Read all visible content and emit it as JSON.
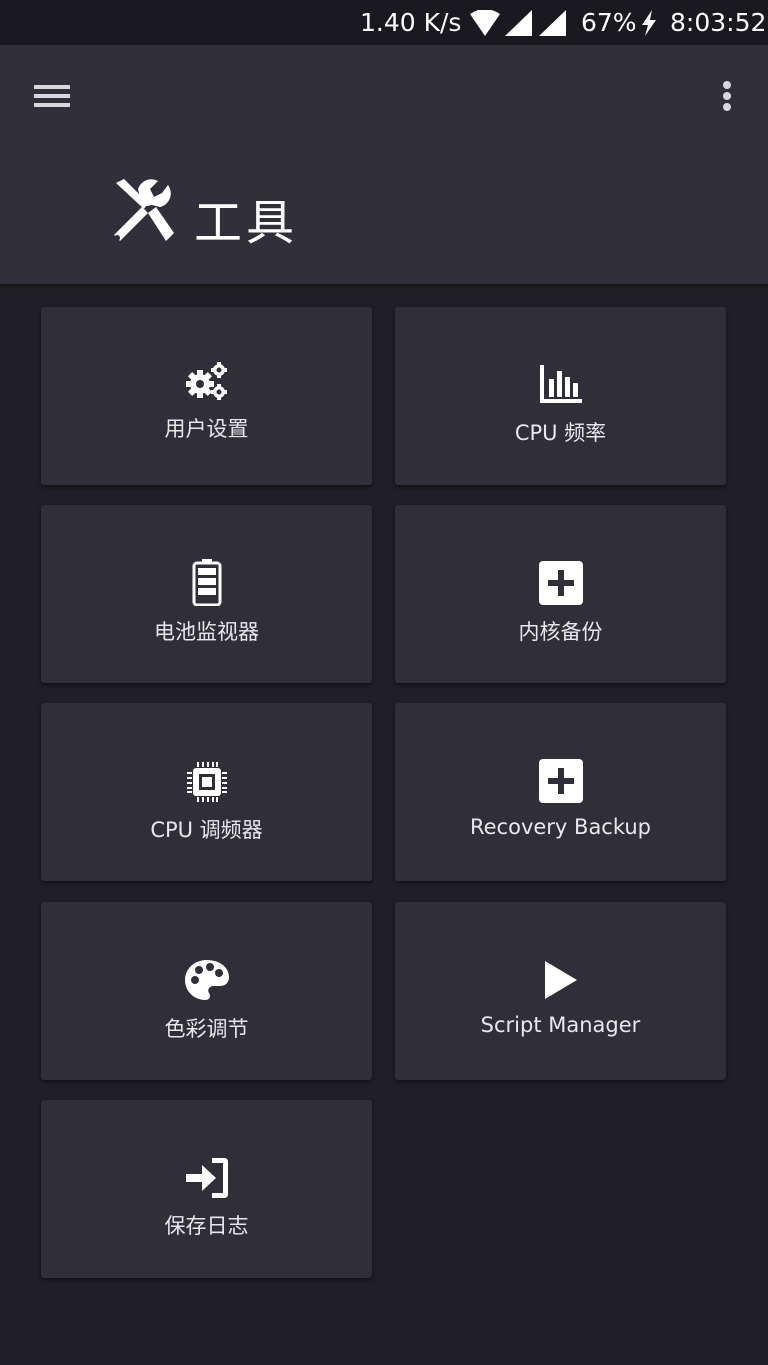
{
  "status_bar": {
    "network_speed": "1.40 K/s",
    "battery": "67%",
    "time": "8:03:52"
  },
  "toolbar": {
    "title": "工具",
    "menu_icon": "hamburger-menu-icon",
    "more_icon": "more-vertical-icon",
    "title_icon": "tools-icon"
  },
  "tiles": [
    {
      "label": "用户设置",
      "icon": "gears-icon"
    },
    {
      "label": "CPU 频率",
      "icon": "bar-chart-icon"
    },
    {
      "label": "电池监视器",
      "icon": "battery-icon"
    },
    {
      "label": "内核备份",
      "icon": "plus-square-icon"
    },
    {
      "label": "CPU 调频器",
      "icon": "cpu-chip-icon"
    },
    {
      "label": "Recovery Backup",
      "icon": "plus-square-icon"
    },
    {
      "label": "色彩调节",
      "icon": "palette-icon"
    },
    {
      "label": "Script Manager",
      "icon": "play-icon"
    },
    {
      "label": "保存日志",
      "icon": "sign-in-icon"
    }
  ],
  "colors": {
    "background": "#201f26",
    "toolbar": "#302f3a",
    "tile": "#2f2e39",
    "text": "#ffffff"
  }
}
